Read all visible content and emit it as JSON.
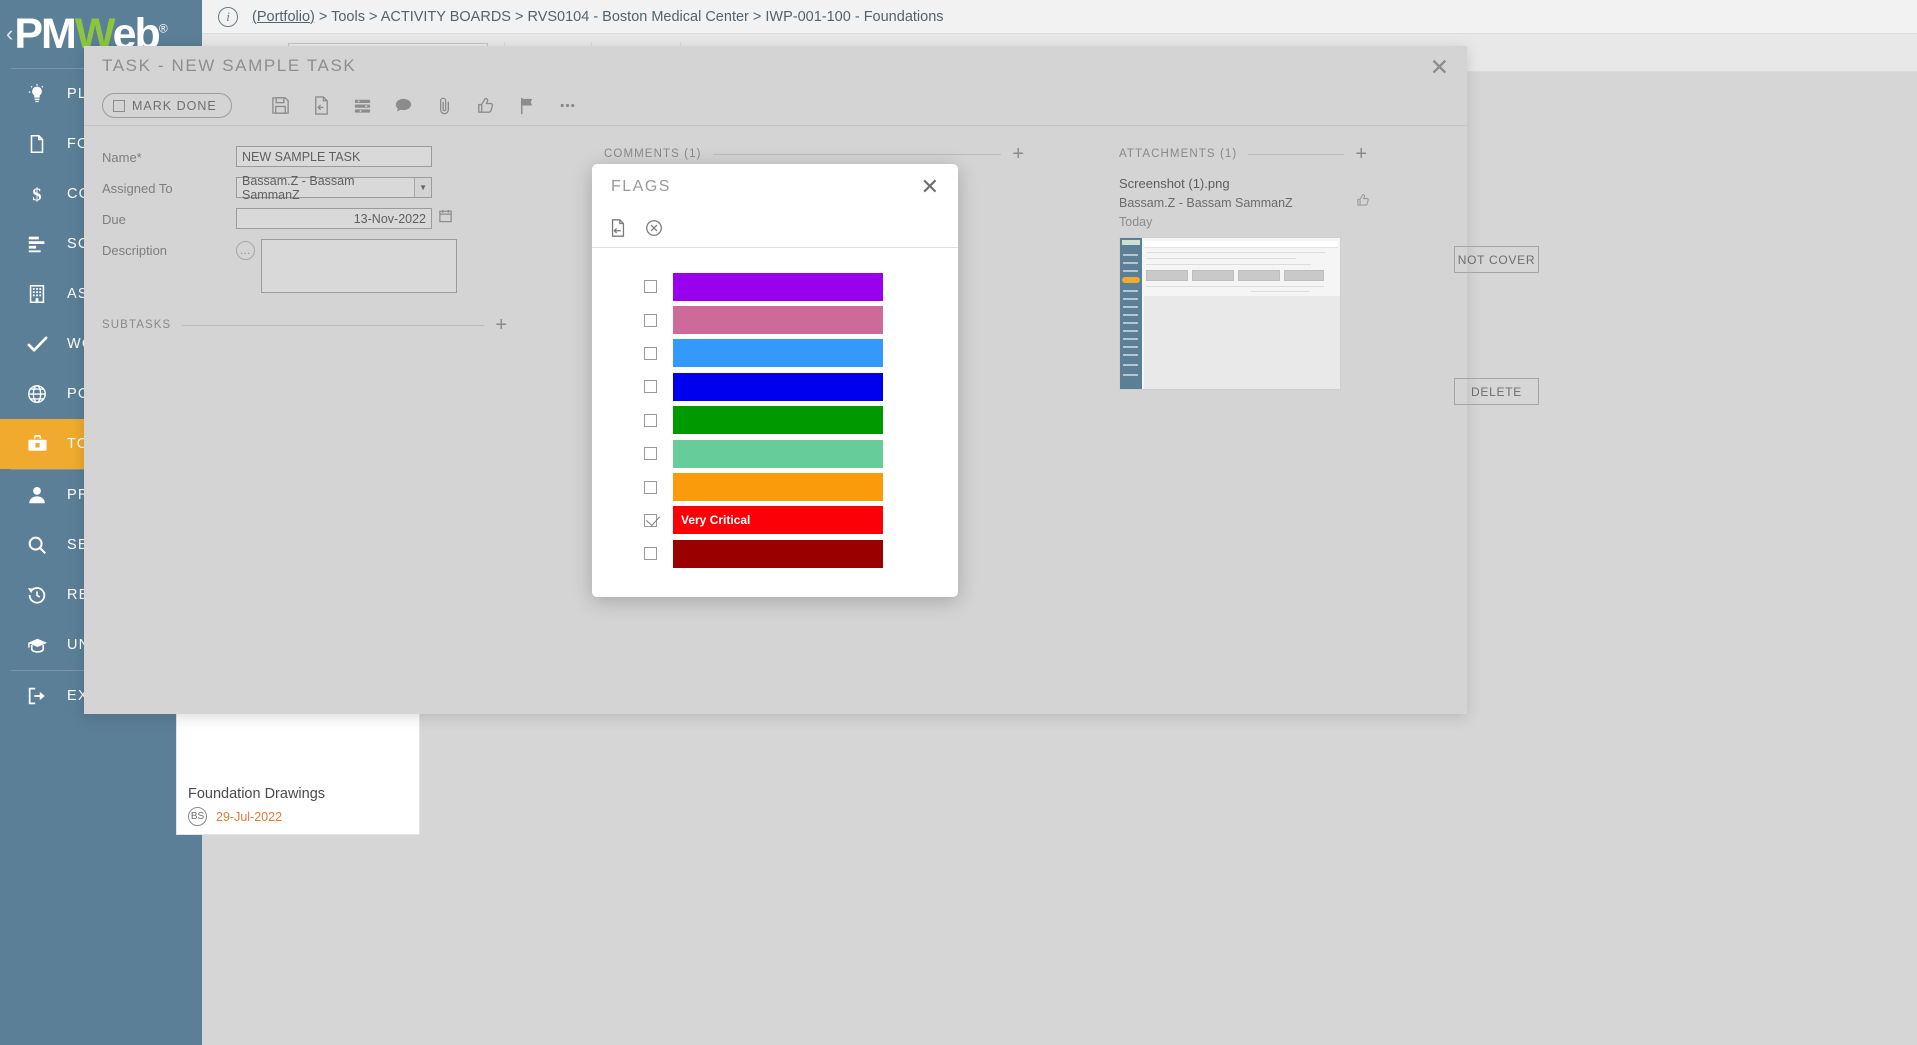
{
  "sidebar": {
    "brand": "PMWeb",
    "brand_reg": "®",
    "items": [
      {
        "label": "PLANS",
        "icon": "lightbulb-icon",
        "active": false
      },
      {
        "label": "FORMS",
        "icon": "document-icon",
        "active": false
      },
      {
        "label": "COSTS",
        "icon": "dollar-icon",
        "active": false
      },
      {
        "label": "SCHEDULES",
        "icon": "schedule-icon",
        "active": false
      },
      {
        "label": "ASSETS",
        "icon": "building-icon",
        "active": false
      },
      {
        "label": "WORKFLOW",
        "icon": "check-icon",
        "active": false
      },
      {
        "label": "PORTFOLIO",
        "icon": "globe-icon",
        "active": false
      },
      {
        "label": "TOOLS",
        "icon": "toolbox-icon",
        "active": true
      },
      {
        "label": "PROFILE",
        "icon": "user-icon",
        "active": false
      },
      {
        "label": "SEARCH",
        "icon": "search-icon",
        "active": false
      },
      {
        "label": "RECENT",
        "icon": "history-icon",
        "active": false
      },
      {
        "label": "UNIVERSITY",
        "icon": "graduation-icon",
        "active": false
      },
      {
        "label": "EXIT",
        "icon": "exit-icon",
        "active": false
      }
    ]
  },
  "topbar": {
    "info_icon": "info-icon",
    "breadcrumb_link": "(Portfolio)",
    "breadcrumb_rest": " > Tools > ACTIVITY BOARDS > RVS0104 - Boston Medical Center > IWP-001-100 - Foundations",
    "project_select": "RVS0104 - Boston Medical Center"
  },
  "task_dialog": {
    "title": "TASK - NEW SAMPLE TASK",
    "close_label": "✕",
    "mark_done_label": "MARK DONE",
    "toolbar_icons": [
      "save-icon",
      "export-icon",
      "rows-icon",
      "comment-icon",
      "attachment-icon",
      "thumbs-up-icon",
      "flag-icon",
      "more-icon"
    ],
    "fields": {
      "name_label": "Name*",
      "name_value": "NEW SAMPLE TASK",
      "assigned_label": "Assigned To",
      "assigned_value": "Bassam.Z - Bassam SammanZ",
      "due_label": "Due",
      "due_value": "13-Nov-2022",
      "description_label": "Description",
      "description_value": ""
    },
    "subtasks_title": "SUBTASKS",
    "comments_title": "COMMENTS (1)",
    "attachments_title": "ATTACHMENTS (1)",
    "add_label": "+",
    "attachment": {
      "filename": "Screenshot (1).png",
      "uploader": "Bassam.Z - Bassam SammanZ",
      "when": "Today",
      "not_cover_label": "NOT COVER",
      "delete_label": "DELETE",
      "like_icon": "thumbs-up-icon"
    }
  },
  "flags_modal": {
    "title": "FLAGS",
    "close_label": "✕",
    "toolbar_icons": [
      "save-exit-icon",
      "cancel-icon"
    ],
    "flags": [
      {
        "color": "#9900ee",
        "label": "",
        "checked": false,
        "name": "flag-purple"
      },
      {
        "color": "#cd6a99",
        "label": "",
        "checked": false,
        "name": "flag-pink"
      },
      {
        "color": "#3399fb",
        "label": "",
        "checked": false,
        "name": "flag-light-blue"
      },
      {
        "color": "#0000ee",
        "label": "",
        "checked": false,
        "name": "flag-blue"
      },
      {
        "color": "#009900",
        "label": "",
        "checked": false,
        "name": "flag-green"
      },
      {
        "color": "#66cc99",
        "label": "",
        "checked": false,
        "name": "flag-mint"
      },
      {
        "color": "#fa9b0c",
        "label": "",
        "checked": false,
        "name": "flag-orange"
      },
      {
        "color": "#fb0006",
        "label": "Very Critical",
        "checked": true,
        "name": "flag-red"
      },
      {
        "color": "#9a0000",
        "label": "",
        "checked": false,
        "name": "flag-dark-red"
      }
    ]
  },
  "background_card": {
    "title": "Foundation Drawings",
    "avatar_initials": "BS",
    "date": "29-Jul-2022"
  },
  "colors": {
    "sidebar_bg": "#5b7f96",
    "accent": "#f0ab2e",
    "dialog_bg": "#d4d4d4",
    "page_bg": "#d6d6d6",
    "date_orange": "#e07b39"
  }
}
